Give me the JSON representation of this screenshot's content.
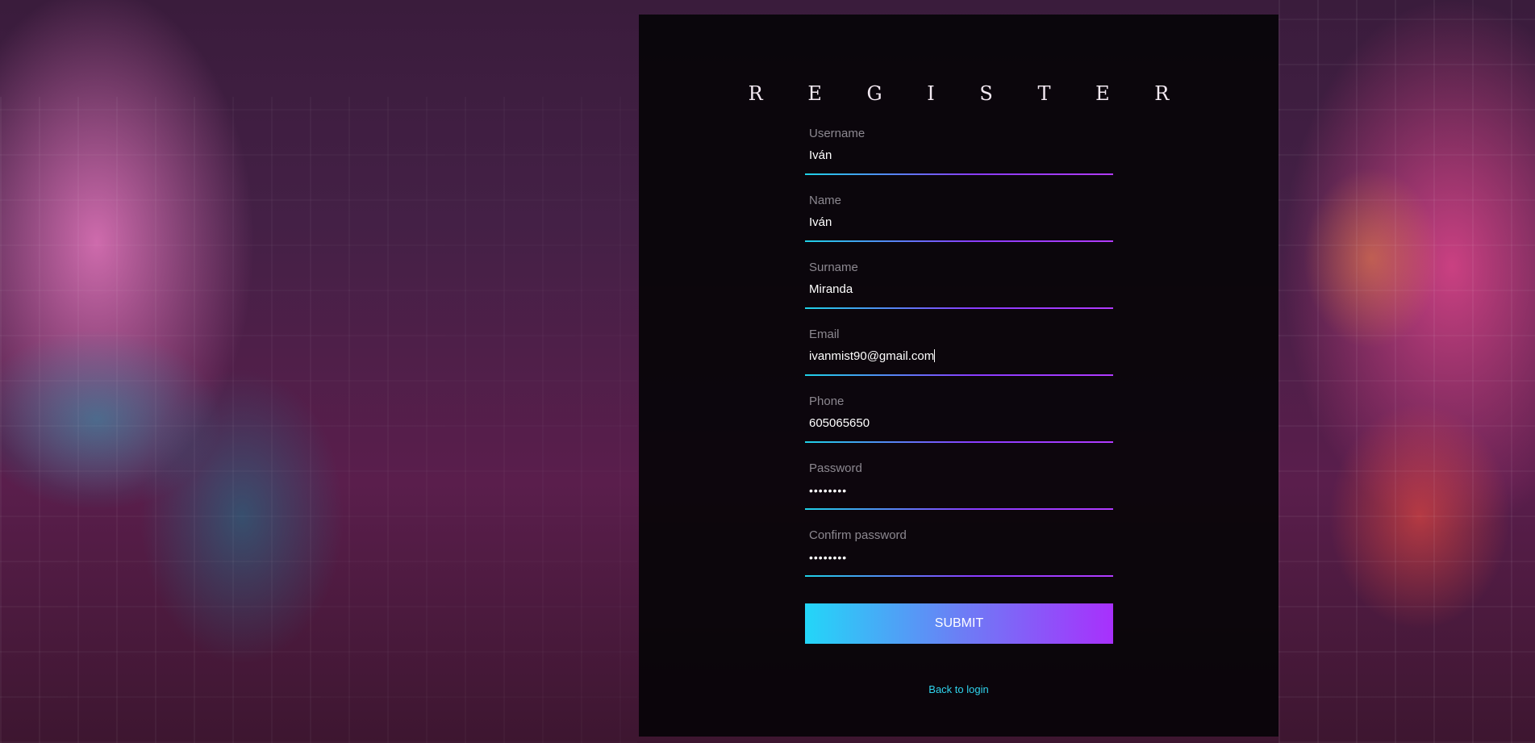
{
  "page": {
    "title": "R E G I S T E R"
  },
  "form": {
    "fields": [
      {
        "label": "Username",
        "value": "Iván",
        "type": "text"
      },
      {
        "label": "Name",
        "value": "Iván",
        "type": "text"
      },
      {
        "label": "Surname",
        "value": "Miranda",
        "type": "text"
      },
      {
        "label": "Email",
        "value": "ivanmist90@gmail.com",
        "type": "email"
      },
      {
        "label": "Phone",
        "value": "605065650",
        "type": "tel"
      },
      {
        "label": "Password",
        "value": "••••••••",
        "type": "password"
      },
      {
        "label": "Confirm password",
        "value": "••••••••",
        "type": "password"
      }
    ],
    "submit_label": "SUBMIT",
    "back_link_label": "Back to login"
  },
  "colors": {
    "accent_start": "#23d6f8",
    "accent_end": "#a830fc",
    "link": "#2fd4ee",
    "panel_bg": "#060408"
  },
  "background": {
    "image": "graffiti-tunnel"
  }
}
